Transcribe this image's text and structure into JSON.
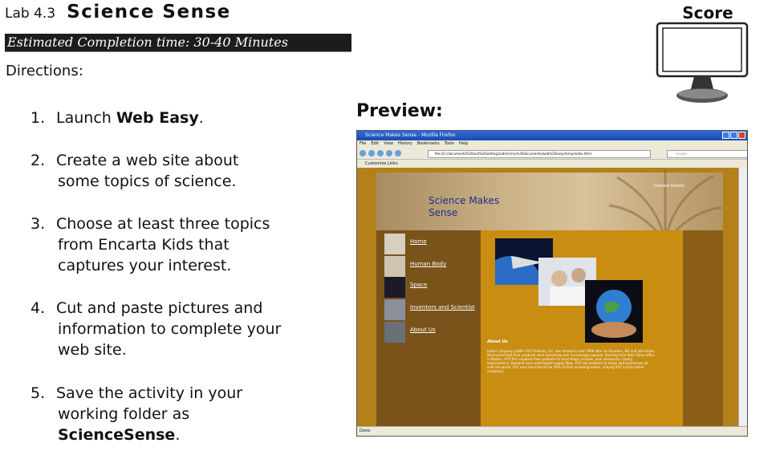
{
  "header": {
    "lab_number": "Lab 4.3",
    "lab_name": "Science Sense"
  },
  "estimated_time": "Estimated Completion time: 30-40 Minutes",
  "directions_label": "Directions:",
  "steps": [
    {
      "num": "1.",
      "pre": "Launch ",
      "bold": "Web Easy",
      "post": "."
    },
    {
      "num": "2.",
      "line1": "Create a web site about",
      "line2": "some topics of science."
    },
    {
      "num": "3.",
      "line1": "Choose at least three topics",
      "line2": "from Encarta Kids that",
      "line3": "captures your interest."
    },
    {
      "num": "4.",
      "line1": "Cut and paste pictures and",
      "line2": "information to complete your",
      "line3": "web site."
    },
    {
      "num": "5.",
      "line1": "Save the activity in your",
      "line2": "working folder as",
      "bold": "ScienceSense",
      "post": "."
    }
  ],
  "score_label": "Score",
  "preview_label": "Preview:",
  "preview": {
    "window_title": "Science Makes Sense - Mozilla Firefox",
    "menu": [
      "File",
      "Edit",
      "View",
      "History",
      "Bookmarks",
      "Tools",
      "Help"
    ],
    "url": "file:///c:/documents%20and%20settings/admin/my%20documents/web%20easy/temp/index.html",
    "search_placeholder": "Google",
    "links_bar": "Customize Links",
    "status": "Done",
    "site_title": "Science Makes Sense",
    "contact": "Contact Details",
    "nav": [
      "Home",
      "Human Body",
      "Space",
      "Inventors and Scientist",
      "About Us"
    ],
    "about_heading": "About Us",
    "about_text": "[enter company profile XYZ Products, Inc. was formed in late 1996 after its founders, Bill and Julie Davis, discovered that their products were becoming ever increasingly popular. Starting from their home office in Boston, XYZ first supplied their products to local shops, schools, and community charity organizations. Demand soon outstripped supply. Now, XYZ sell products to shops and businesses all over the world. XYZ uses the Internet for 90% of their incoming orders, making XYZ a truly online company.]"
  }
}
